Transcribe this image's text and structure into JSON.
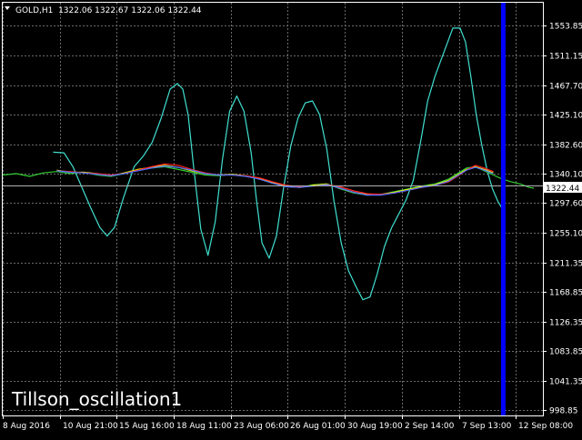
{
  "header": {
    "symbol_line": "GOLD,H1  1322.06 1322.67 1322.06 1322.44",
    "dropdown_icon": "triangle-down-icon"
  },
  "watermark": "Tillson_oscillation1",
  "current_price_label": "1322.44",
  "colors": {
    "background": "#000000",
    "grid": "#6b6b6b",
    "axis_text": "#ffffff",
    "oscillator": "#40e0d0",
    "price_green": "#32cd32",
    "price_yellow": "#ffff00",
    "price_red": "#ff2020",
    "price_blue": "#4a6cff",
    "price_line": "#b0b0b0",
    "cursor_line": "#0000ff"
  },
  "chart_data": {
    "type": "line",
    "title": "GOLD,H1  1322.06 1322.67 1322.06 1322.44",
    "xlabel": "",
    "ylabel": "",
    "ylim": [
      998.85,
      1574.0
    ],
    "y_ticks": [
      "1553.85",
      "1511.15",
      "1467.70",
      "1425.10",
      "1382.60",
      "1340.10",
      "1297.60",
      "1255.10",
      "1211.35",
      "1168.85",
      "1126.35",
      "1083.85",
      "1041.35",
      "998.85"
    ],
    "x_ticks": [
      "8 Aug 2016",
      "10 Aug 21:00",
      "15 Aug 16:00",
      "18 Aug 11:00",
      "23 Aug 06:00",
      "26 Aug 01:00",
      "30 Aug 19:00",
      "2 Sep 14:00",
      "7 Sep 13:00",
      "12 Sep 08:00"
    ],
    "x_range": [
      0,
      600
    ],
    "grid": true,
    "current_price": 1322.44,
    "cursor_x": 556,
    "series": [
      {
        "key": "oscillator",
        "color": "#40e0d0",
        "x": [
          56,
          68,
          78,
          88,
          98,
          108,
          116,
          124,
          134,
          146,
          156,
          166,
          176,
          186,
          194,
          200,
          206,
          212,
          220,
          228,
          236,
          244,
          252,
          260,
          268,
          276,
          282,
          288,
          296,
          304,
          312,
          320,
          328,
          336,
          344,
          352,
          360,
          368,
          376,
          384,
          392,
          400,
          408,
          416,
          424,
          432,
          440,
          448,
          456,
          464,
          472,
          480,
          490,
          500,
          508,
          514,
          520,
          526,
          532,
          538,
          544,
          550,
          556
        ],
        "y": [
          1371,
          1370,
          1350,
          1320,
          1290,
          1262,
          1250,
          1262,
          1305,
          1350,
          1365,
          1385,
          1420,
          1462,
          1470,
          1462,
          1425,
          1350,
          1260,
          1222,
          1270,
          1360,
          1430,
          1452,
          1430,
          1370,
          1300,
          1240,
          1218,
          1250,
          1320,
          1380,
          1420,
          1442,
          1445,
          1425,
          1375,
          1300,
          1240,
          1200,
          1178,
          1158,
          1162,
          1195,
          1235,
          1262,
          1282,
          1302,
          1330,
          1385,
          1445,
          1480,
          1515,
          1550,
          1550,
          1530,
          1480,
          1425,
          1382,
          1345,
          1318,
          1300,
          1287
        ]
      },
      {
        "key": "price_green",
        "color": "#32cd32",
        "x": [
          0,
          15,
          30,
          45,
          60,
          75,
          90,
          105,
          120,
          135,
          150,
          165,
          180,
          195,
          210,
          225,
          240,
          255,
          270,
          285,
          300,
          315,
          330,
          345,
          360,
          375,
          390,
          405,
          420,
          435,
          450,
          465,
          480,
          495,
          505,
          515,
          525,
          535,
          545,
          555,
          565,
          575,
          585,
          590
        ],
        "y": [
          1338,
          1340,
          1336,
          1341,
          1343,
          1340,
          1342,
          1338,
          1336,
          1340,
          1345,
          1348,
          1350,
          1346,
          1342,
          1338,
          1337,
          1339,
          1336,
          1333,
          1326,
          1322,
          1320,
          1324,
          1325,
          1318,
          1312,
          1309,
          1310,
          1314,
          1318,
          1322,
          1325,
          1332,
          1340,
          1348,
          1350,
          1344,
          1338,
          1332,
          1328,
          1325,
          1320,
          1319
        ]
      },
      {
        "key": "price_yellow",
        "color": "#ffff00",
        "x": [
          60,
          75,
          90,
          105,
          120,
          135,
          150,
          165,
          180,
          195,
          210,
          225,
          240,
          255,
          270,
          285,
          300,
          315,
          330,
          345,
          360,
          375,
          390,
          405,
          420,
          435,
          450,
          465,
          480,
          495,
          505,
          515,
          525,
          535,
          545
        ],
        "y": [
          1345,
          1342,
          1342,
          1340,
          1337,
          1341,
          1346,
          1349,
          1352,
          1349,
          1344,
          1340,
          1338,
          1339,
          1337,
          1333,
          1327,
          1322,
          1320,
          1323,
          1325,
          1319,
          1313,
          1310,
          1310,
          1313,
          1317,
          1321,
          1324,
          1330,
          1338,
          1346,
          1350,
          1346,
          1341
        ]
      },
      {
        "key": "price_red",
        "color": "#ff2020",
        "x": [
          60,
          75,
          90,
          105,
          120,
          135,
          150,
          165,
          180,
          195,
          210,
          225,
          240,
          255,
          270,
          285,
          300,
          315,
          330,
          345,
          360,
          375,
          390,
          405,
          420,
          435,
          450,
          465,
          480,
          495,
          505,
          515,
          525,
          535,
          545
        ],
        "y": [
          1344,
          1343,
          1341,
          1340,
          1338,
          1340,
          1345,
          1350,
          1354,
          1352,
          1346,
          1341,
          1338,
          1338,
          1337,
          1334,
          1328,
          1323,
          1321,
          1322,
          1324,
          1321,
          1315,
          1311,
          1310,
          1312,
          1316,
          1320,
          1323,
          1328,
          1336,
          1345,
          1352,
          1348,
          1343
        ]
      },
      {
        "key": "price_blue",
        "color": "#4a6cff",
        "x": [
          60,
          75,
          90,
          105,
          120,
          135,
          150,
          165,
          180,
          195,
          210,
          225,
          240,
          255,
          270,
          285,
          300,
          315,
          330,
          345,
          360,
          375,
          390,
          405,
          420,
          435,
          450,
          465,
          480,
          495,
          505,
          515,
          525,
          535,
          545
        ],
        "y": [
          1344,
          1342,
          1341,
          1339,
          1337,
          1340,
          1344,
          1348,
          1351,
          1349,
          1345,
          1340,
          1338,
          1338,
          1336,
          1332,
          1326,
          1321,
          1320,
          1322,
          1324,
          1319,
          1313,
          1309,
          1309,
          1312,
          1316,
          1320,
          1323,
          1329,
          1337,
          1345,
          1349,
          1345,
          1340
        ]
      }
    ]
  }
}
